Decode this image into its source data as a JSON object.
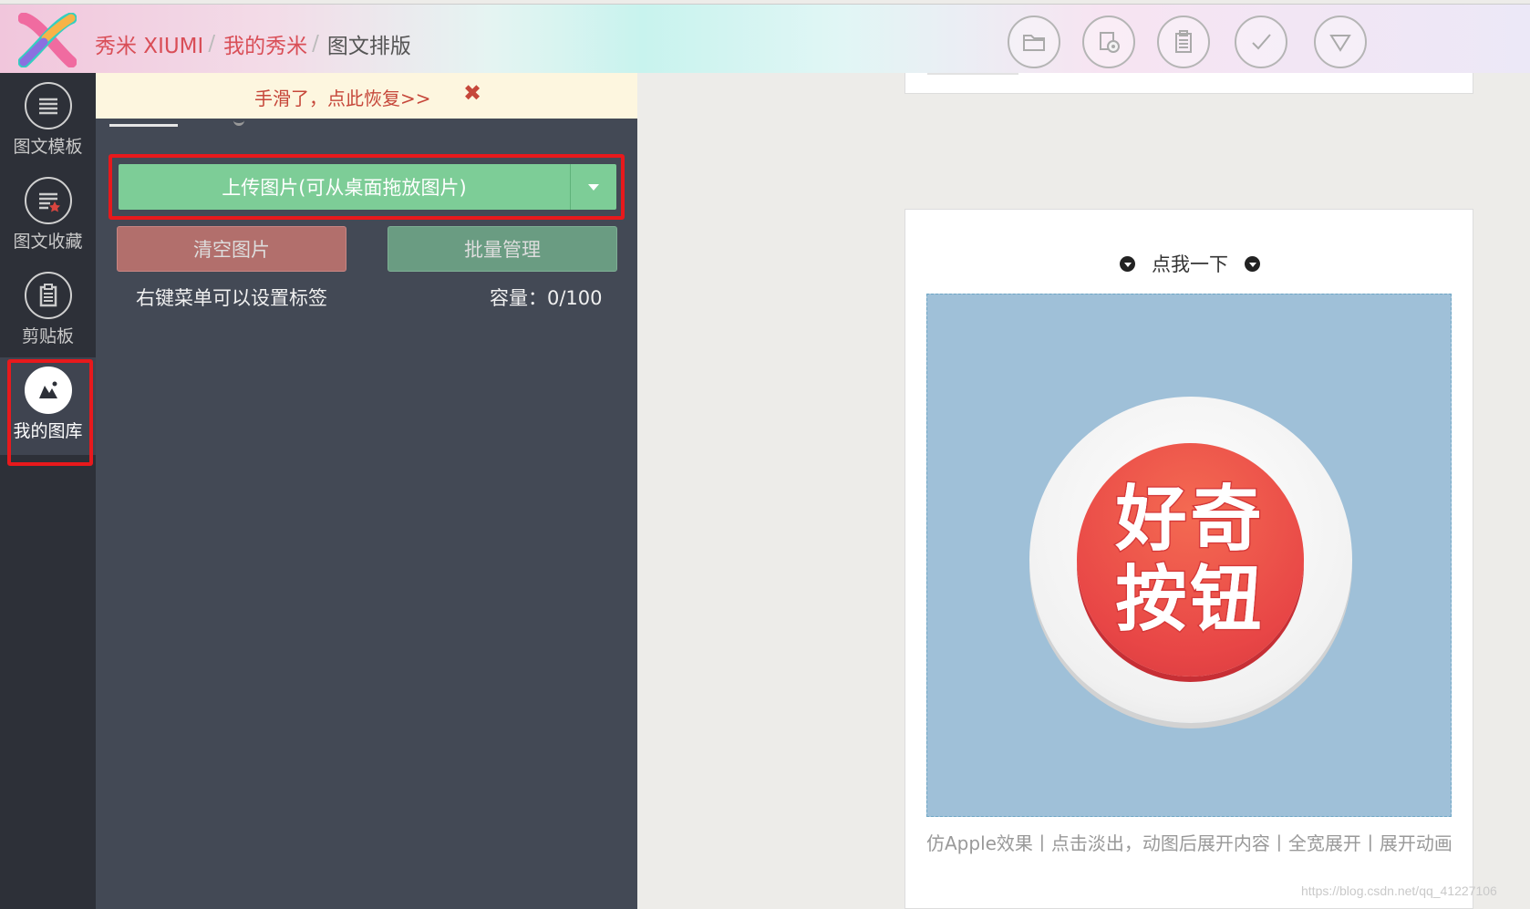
{
  "header": {
    "breadcrumbs": [
      "秀米 XIUMI",
      "我的秀米",
      "图文排版"
    ],
    "separator": "/",
    "toolbar": [
      {
        "icon": "folder-icon",
        "label": ""
      },
      {
        "icon": "preview-icon",
        "label": ""
      },
      {
        "icon": "clipboard-icon",
        "label": ""
      },
      {
        "icon": "check-icon",
        "label": ""
      },
      {
        "icon": "dropdown-triangle-icon",
        "label": ""
      }
    ]
  },
  "sidebar": {
    "items": [
      {
        "label": "图文模板",
        "icon": "list-icon",
        "active": false
      },
      {
        "label": "图文收藏",
        "icon": "favorites-icon",
        "active": false
      },
      {
        "label": "剪贴板",
        "icon": "clipboard-icon",
        "active": false
      },
      {
        "label": "我的图库",
        "icon": "gallery-icon",
        "active": true
      }
    ]
  },
  "panel": {
    "notice": {
      "text": "手滑了，点此恢复>>",
      "close": "✖"
    },
    "upload_label": "上传图片(可从桌面拖放图片)",
    "clear_label": "清空图片",
    "batch_label": "批量管理",
    "hint": "右键菜单可以设置标签",
    "capacity": "容量：0/100"
  },
  "preview": {
    "click_label": "点我一下",
    "button_text_line1": "好奇",
    "button_text_line2": "按钮",
    "caption": "仿Apple效果丨点击淡出，动图后展开内容丨全宽展开丨展开动画"
  },
  "watermark": "https://blog.csdn.net/qq_41227106",
  "colors": {
    "accent_red": "#d94e57",
    "upload_green": "#7dcd97",
    "clear_red": "#b26f6c",
    "batch_green": "#6a9c82",
    "highlight_box": "#e8191c",
    "panel_bg": "#434955",
    "sidebar_bg": "#2d3038"
  }
}
